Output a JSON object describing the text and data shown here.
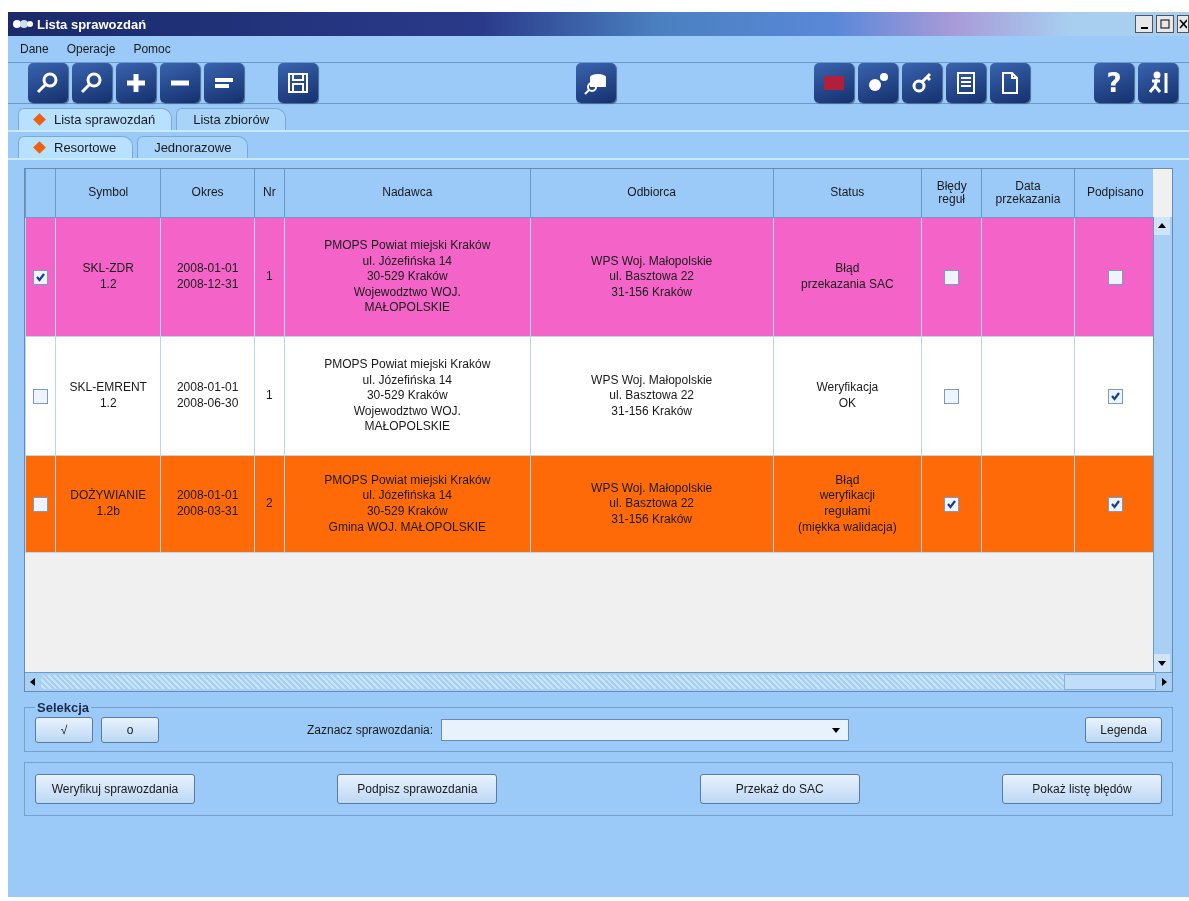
{
  "window": {
    "title": "Lista sprawozdań"
  },
  "menu": [
    {
      "label": "Dane"
    },
    {
      "label": "Operacje"
    },
    {
      "label": "Pomoc"
    }
  ],
  "toolbar": {
    "help_label": "?"
  },
  "tabs": [
    {
      "label": "Lista sprawozdań",
      "selected": true
    },
    {
      "label": "Lista zbiorów",
      "selected": false
    }
  ],
  "subtabs": [
    {
      "label": "Resortowe",
      "selected": true
    },
    {
      "label": "Jednorazowe",
      "selected": false
    }
  ],
  "table": {
    "columns": [
      "Symbol",
      "Okres",
      "Nr",
      "Nadawca",
      "Odbiorca",
      "Status",
      "Błędy reguł",
      "Data przekazania",
      "Podpisano"
    ],
    "rows": [
      {
        "color": "#f464c8",
        "checked": true,
        "symbol": "SKL-ZDR\n1.2",
        "period": "2008-01-01\n2008-12-31",
        "nr": "1",
        "sender": "PMOPS Powiat miejski Kraków\nul. Józefińska 14\n30-529 Kraków\nWojewodztwo WOJ.\nMAŁOPOLSKIE",
        "recipient": "WPS Woj. Małopolskie\nul. Basztowa 22\n31-156 Kraków",
        "status": "Błąd\nprzekazania SAC",
        "rule_errors": false,
        "signed": false
      },
      {
        "color": "#ffffff",
        "checked": false,
        "symbol": "SKL-EMRENT\n1.2",
        "period": "2008-01-01\n2008-06-30",
        "nr": "1",
        "sender": "PMOPS Powiat miejski Kraków\nul. Józefińska 14\n30-529 Kraków\nWojewodztwo WOJ.\nMAŁOPOLSKIE",
        "recipient": "WPS Woj. Małopolskie\nul. Basztowa 22\n31-156 Kraków",
        "status": "Weryfikacja\nOK",
        "rule_errors": false,
        "signed": true
      },
      {
        "color": "#ff6a08",
        "checked": false,
        "symbol": "DOŻYWIANIE\n1.2b",
        "period": "2008-01-01\n2008-03-31",
        "nr": "2",
        "sender": "PMOPS Powiat miejski Kraków\nul. Józefińska 14\n30-529 Kraków\nGmina WOJ. MAŁOPOLSKIE",
        "recipient": "WPS Woj. Małopolskie\nul. Basztowa 22\n31-156 Kraków",
        "status": "Błąd\nweryfikacji\nregułami\n(miękka walidacja)",
        "rule_errors": true,
        "signed": true
      }
    ]
  },
  "selection": {
    "title": "Selekcja",
    "buttons": [
      "√",
      "o"
    ],
    "combo_label": "Zaznacz sprawozdania:",
    "legend_button": "Legenda"
  },
  "actions": [
    "Weryfikuj sprawozdania",
    "Podpisz sprawozdania",
    "Przekaż do SAC",
    "Pokaż listę błędów"
  ]
}
